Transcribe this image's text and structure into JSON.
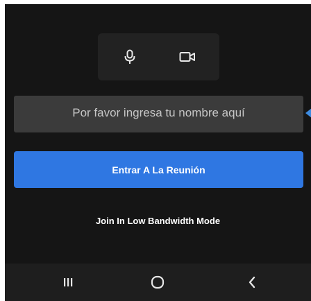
{
  "media_controls": {
    "mic_icon": "microphone-icon",
    "camera_icon": "video-camera-icon"
  },
  "name_input": {
    "placeholder": "Por favor ingresa tu nombre aquí",
    "value": ""
  },
  "join_button": {
    "label": "Entrar A La Reunión"
  },
  "low_bandwidth": {
    "label": "Join In Low Bandwidth Mode"
  },
  "nav_bar": {
    "recents_icon": "recent-apps-icon",
    "home_icon": "home-icon",
    "back_icon": "back-icon"
  },
  "colors": {
    "background": "#151515",
    "accent": "#2f77e2",
    "input_background": "#3b3b3b",
    "nav_background": "#1e1e1e"
  }
}
